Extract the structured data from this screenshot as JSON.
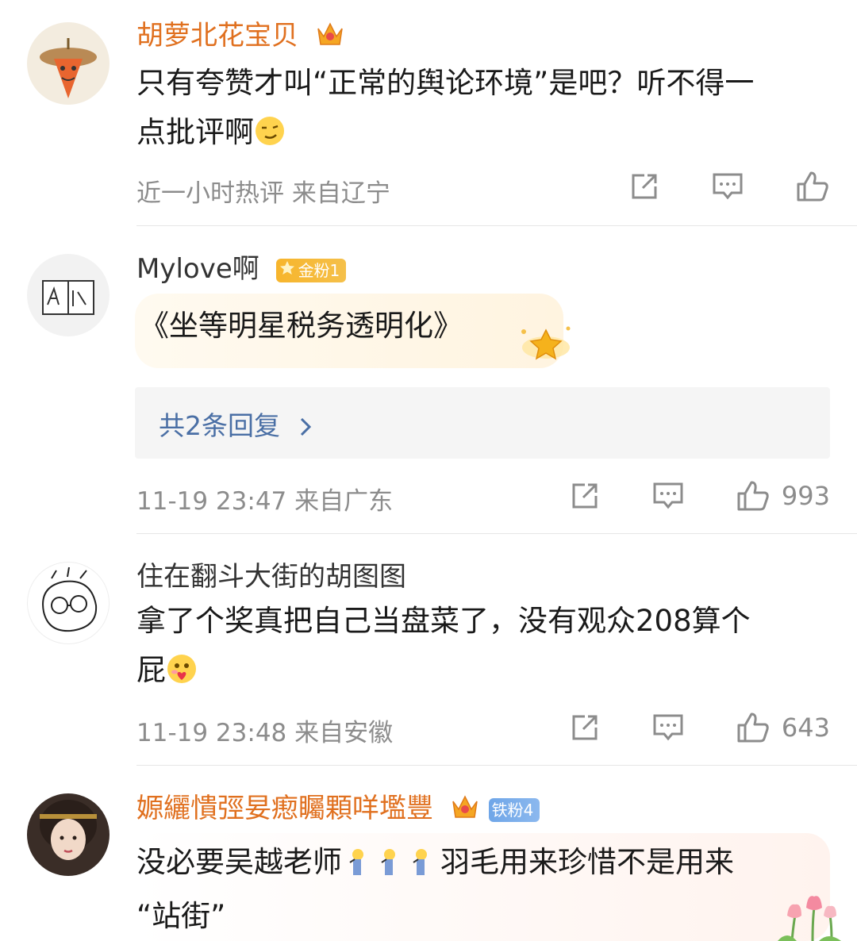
{
  "comments": [
    {
      "username": "胡萝北花宝贝",
      "text_line1": "只有夸赞才叫“正常的舆论环境”是吧？听不得一",
      "text_line2": "点批评啊",
      "emoji": "smirk-emoji",
      "meta": "近一小时热评  来自辽宁",
      "likes": ""
    },
    {
      "username": "Mylove啊",
      "badge": "金粉1",
      "text": "《坐等明星税务透明化》",
      "replies": "共2条回复",
      "meta": "11-19 23:47  来自广东",
      "likes": "993"
    },
    {
      "username": "住在翻斗大街的胡图图",
      "text_line1": "拿了个奖真把自己当盘菜了，没有观众208算个",
      "text_line2": "屁",
      "emoji": "heart-face-emoji",
      "meta": "11-19 23:48  来自安徽",
      "likes": "643"
    },
    {
      "username": "嫄纚憒弳妟瘛矚顆咩壏豐",
      "badge": "铁粉4",
      "text_a": "没必要吴越老师",
      "text_b": "羽毛用来珍惜不是用来",
      "text_line2": "“站街”"
    }
  ],
  "colors": {
    "gold_name": "#e0701f",
    "reply_link": "#4a6fa5",
    "meta": "#8c8c8c"
  },
  "icons": [
    "share-icon",
    "comment-icon",
    "like-icon",
    "chevron-right-icon",
    "crown-icon",
    "tulip-icon"
  ]
}
